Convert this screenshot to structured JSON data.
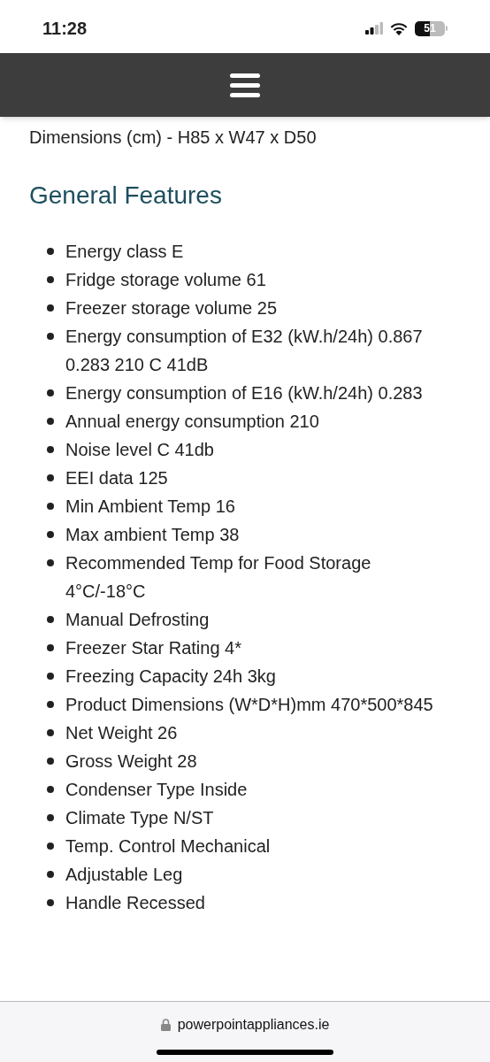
{
  "status_bar": {
    "time": "11:28",
    "battery": "51"
  },
  "content": {
    "intro": "Dimensions (cm) - H85 x W47 x D50",
    "heading": "General Features",
    "features": [
      "Energy class E",
      "Fridge storage volume 61",
      "Freezer storage volume 25",
      "Energy consumption of E32 (kW.h/24h) 0.867 0.283 210 C 41dB",
      "Energy consumption of E16 (kW.h/24h) 0.283",
      "Annual energy consumption 210",
      "Noise level C 41db",
      "EEI data 125",
      "Min Ambient Temp 16",
      "Max ambient Temp 38",
      "Recommended Temp for Food Storage 4°C/-18°C",
      "Manual Defrosting",
      "Freezer Star Rating 4*",
      "Freezing Capacity 24h 3kg",
      "Product Dimensions (W*D*H)mm 470*500*845",
      "Net Weight 26",
      "Gross Weight 28",
      "Condenser Type Inside",
      "Climate Type N/ST",
      "Temp. Control Mechanical",
      "Adjustable Leg",
      "Handle Recessed"
    ]
  },
  "address_bar": {
    "url": "powerpointappliances.ie"
  }
}
